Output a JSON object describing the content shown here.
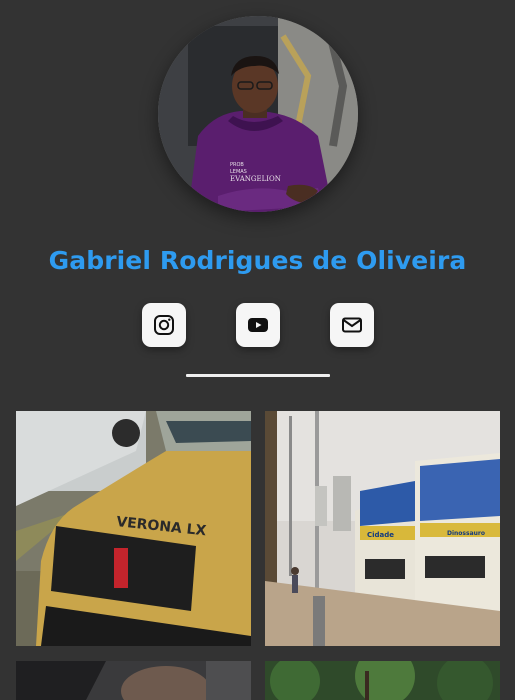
{
  "profile": {
    "name": "Gabriel Rodrigues de Oliveira",
    "avatar_shirt_text_1": "PROB",
    "avatar_shirt_text_2": "LEMAS",
    "avatar_shirt_text_3": "EVANGELION"
  },
  "social": [
    {
      "name": "instagram",
      "icon": "instagram-icon"
    },
    {
      "name": "youtube",
      "icon": "youtube-icon"
    },
    {
      "name": "email",
      "icon": "mail-icon"
    }
  ],
  "gallery": {
    "photos": [
      {
        "badge": "VERONA LX"
      },
      {
        "bus_sign_1": "Cidade",
        "bus_sign_2": "Dinossauro"
      },
      {},
      {}
    ]
  },
  "colors": {
    "background": "#333333",
    "name_accent": "#2e9bf0",
    "button_bg": "#f6f6f6"
  }
}
